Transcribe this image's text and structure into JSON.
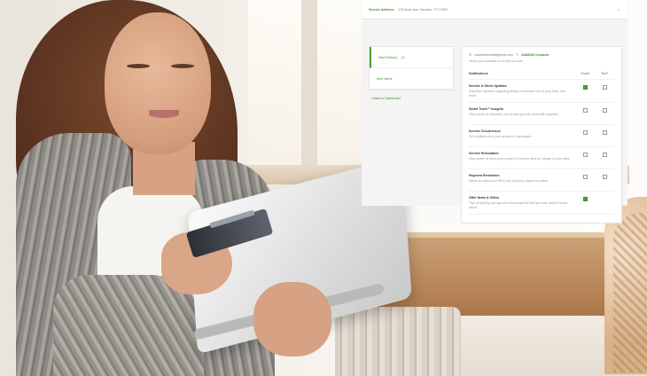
{
  "dashboard": {
    "service_address_label": "Service Address:",
    "service_address_value": "123 Ansel Ave, Houston, TX 77002",
    "nav": [
      {
        "label": "Alert Delivery",
        "count": "(2)",
        "active": true
      },
      {
        "label": "Alert Alerts",
        "count": "",
        "active": false
      }
    ],
    "back_link": "< Back to Dashboard",
    "contact_email": "customeremail@gmail.com",
    "edit_link": "Add/Edit Contacts",
    "sub_note": "Verify your contacts in the My Account",
    "columns": {
      "name": "Notifications",
      "email": "Email",
      "text": "Text*"
    },
    "notifications": [
      {
        "title": "Service & Street Updates",
        "desc": "Important updates regarding delays, excessive use in your area, and more.",
        "email": true,
        "text": false
      },
      {
        "title": "Smart Track™ Insights",
        "desc": "Stay aware of electricity use so that you can avoid bill surprises.",
        "email": false,
        "text": false
      },
      {
        "title": "Service Occurrences",
        "desc": "Get notified when your service is interrupted.",
        "email": false,
        "text": false
      },
      {
        "title": "Service Restoration",
        "desc": "Stay aware of when your power is restored after an outage in your area.",
        "email": false,
        "text": false
      },
      {
        "title": "Payment Reminders",
        "desc": "Alerts on when your bill is due and your payment posted.",
        "email": false,
        "text": false
      },
      {
        "title": "Offer News & Offers",
        "desc": "Tips on getting savings and new programs that you may want to know about.",
        "email": true,
        "text": null
      }
    ]
  }
}
